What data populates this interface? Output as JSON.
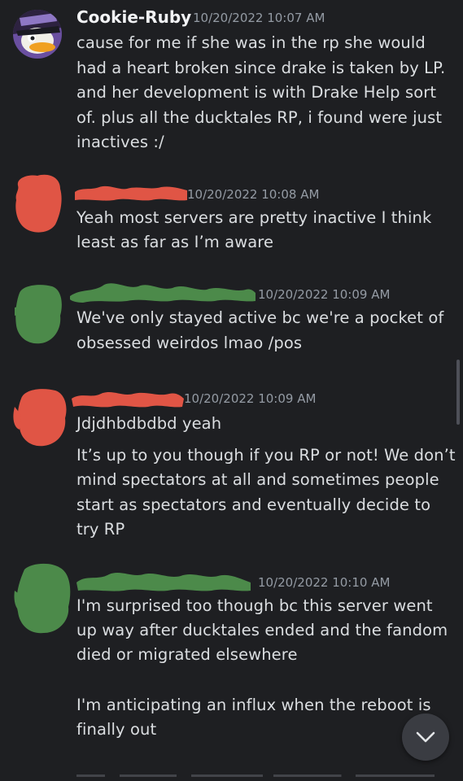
{
  "colors": {
    "background": "#1e1f22",
    "redact_red": "#e05545",
    "redact_green": "#4c8a4a",
    "username": "#f2f3f5",
    "timestamp": "#949ba4",
    "text": "#dbdee1"
  },
  "messages": [
    {
      "username": "Cookie-Ruby",
      "timestamp": "10/20/2022 10:07 AM",
      "avatar_icon": "duck-character-avatar",
      "lines": [
        "cause for me if she was in the rp she would",
        "had a heart broken since drake is taken by LP.",
        "and her development is with Drake Help sort",
        "of. plus all the ducktales RP, i found were just",
        "inactives :/"
      ]
    },
    {
      "timestamp": "10/20/2022 10:08 AM",
      "redaction": "red",
      "lines": [
        "Yeah most servers are pretty inactive I think",
        "least as far as I’m aware"
      ]
    },
    {
      "timestamp": "10/20/2022 10:09 AM",
      "redaction": "green",
      "lines": [
        "We've only stayed active bc we're a pocket of",
        "obsessed weirdos lmao  /pos"
      ]
    },
    {
      "timestamp": "10/20/2022 10:09 AM",
      "redaction": "red",
      "lines": [
        "Jdjdhbdbdbd yeah",
        "It’s up to you though if you RP or not! We don’t",
        "mind spectators at all and sometimes people",
        "start as spectators and eventually decide to",
        "try RP"
      ]
    },
    {
      "timestamp": "10/20/2022 10:10 AM",
      "redaction": "green",
      "lines": [
        "I'm surprised too though bc this server went",
        "up way after ducktales ended and the fandom",
        "died or migrated elsewhere",
        "I'm anticipating an influx when the reboot is",
        "finally out"
      ]
    }
  ],
  "jump_button_icon": "chevron-down-icon"
}
